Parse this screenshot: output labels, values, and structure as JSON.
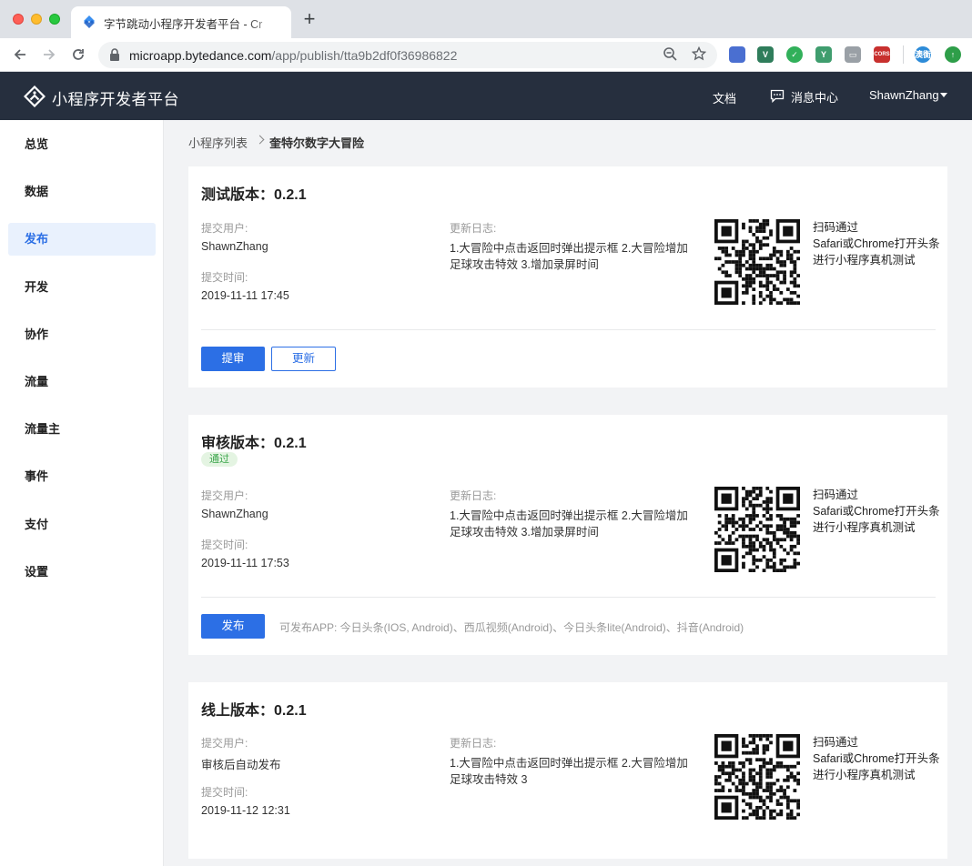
{
  "browser": {
    "tab_title": "字节跳动小程序开发者平台 - Cr",
    "new_tab": "+",
    "url_host": "microapp.bytedance.com",
    "url_path": "/app/publish/tta9b2df0f36986822",
    "extensions": [
      {
        "name": "earth-extension-icon",
        "label": "",
        "color": "#4a6fd1"
      },
      {
        "name": "vue-devtools-icon",
        "label": "V",
        "color": "#2f7d5b"
      },
      {
        "name": "check-extension-icon",
        "label": "✓",
        "color": "#31b05a"
      },
      {
        "name": "v-extension-icon",
        "label": "Y",
        "color": "#3f9d6e"
      },
      {
        "name": "card-extension-icon",
        "label": "▭",
        "color": "#9aa0a6"
      },
      {
        "name": "cors-extension-icon",
        "label": "CORS",
        "color": "#c8302e"
      },
      {
        "name": "translate-extension-icon",
        "label": "澳衡",
        "color": "#2d8bd8"
      },
      {
        "name": "update-arrow-icon",
        "label": "↑",
        "color": "#2e9e49"
      }
    ]
  },
  "header": {
    "logo_text": "小程序开发者平台",
    "docs": "文档",
    "messages": "消息中心",
    "user": "ShawnZhang"
  },
  "sidebar": {
    "items": [
      {
        "label": "总览"
      },
      {
        "label": "数据"
      },
      {
        "label": "发布",
        "active": true
      },
      {
        "label": "开发"
      },
      {
        "label": "协作"
      },
      {
        "label": "流量"
      },
      {
        "label": "流量主"
      },
      {
        "label": "事件"
      },
      {
        "label": "支付"
      },
      {
        "label": "设置"
      }
    ]
  },
  "breadcrumb": {
    "parent": "小程序列表",
    "current": "奎特尔数字大冒险"
  },
  "labels": {
    "submitter": "提交用户:",
    "submit_time": "提交时间:",
    "changelog": "更新日志:"
  },
  "qr_tip": {
    "line1": "扫码通过",
    "line2": "Safari或Chrome打开头条",
    "line3": "进行小程序真机测试"
  },
  "cards": {
    "test": {
      "title": "测试版本：0.2.1",
      "submitter": "ShawnZhang",
      "time": "2019-11-11 17:45",
      "log": "1.大冒险中点击返回时弹出提示框 2.大冒险增加足球攻击特效 3.增加录屏时间",
      "btn_review": "提审",
      "btn_update": "更新"
    },
    "review": {
      "title": "审核版本：0.2.1",
      "status": "通过",
      "submitter": "ShawnZhang",
      "time": "2019-11-11 17:53",
      "log": "1.大冒险中点击返回时弹出提示框 2.大冒险增加足球攻击特效 3.增加录屏时间",
      "btn_publish": "发布",
      "publish_note": "可发布APP: 今日头条(IOS, Android)、西瓜视频(Android)、今日头条lite(Android)、抖音(Android)"
    },
    "online": {
      "title": "线上版本：0.2.1",
      "submitter": "审核后自动发布",
      "time": "2019-11-12 12:31",
      "log": "1.大冒险中点击返回时弹出提示框 2.大冒险增加足球攻击特效 3"
    }
  }
}
